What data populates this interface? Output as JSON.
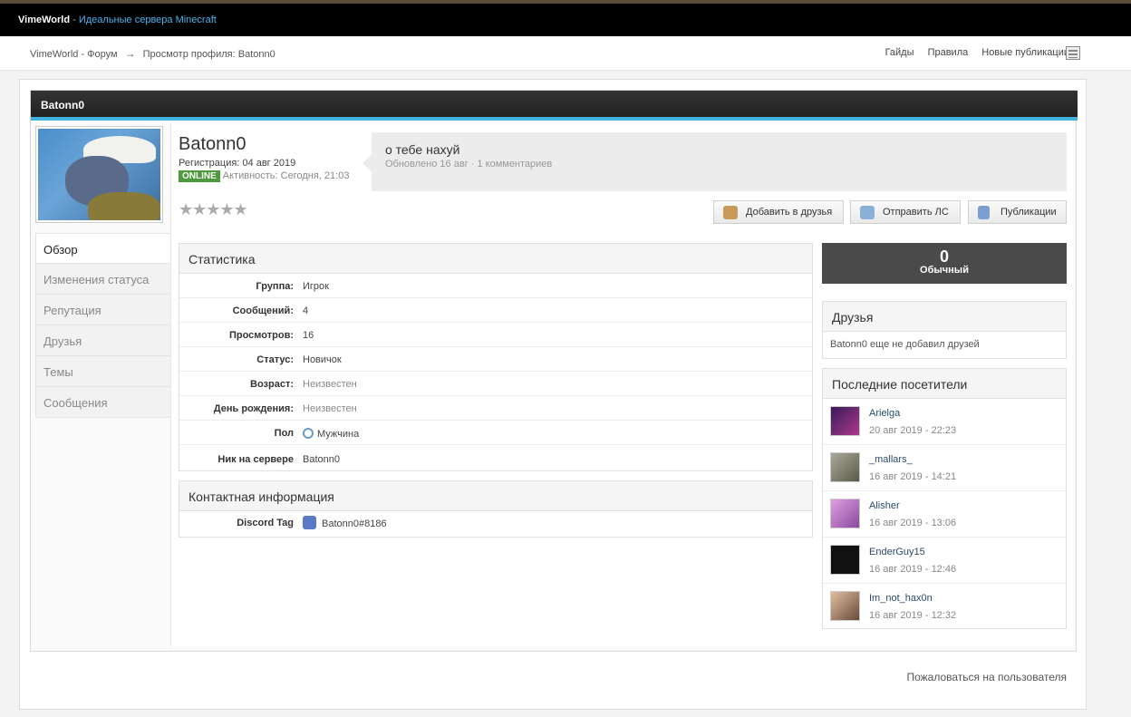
{
  "topbar": {
    "site": "VimeWorld",
    "sep": " - ",
    "tagline": "Идеальные сервера Minecraft"
  },
  "navbar": {
    "breadcrumbs": [
      "VimeWorld - Форум",
      "Просмотр профиля: Batonn0"
    ],
    "arrow": "→",
    "links": [
      "Гайды",
      "Правила",
      "Новые публикации"
    ]
  },
  "card": {
    "title": "Batonn0"
  },
  "sidenav": [
    "Обзор",
    "Изменения статуса",
    "Репутация",
    "Друзья",
    "Темы",
    "Сообщения"
  ],
  "profile": {
    "name": "Batonn0",
    "registered": "Регистрация: 04 авг 2019",
    "online_badge": "ONLINE",
    "activity": "Активность: Сегодня, 21:03",
    "stars": "★★★★★"
  },
  "status": {
    "text": "о тебе нахуй",
    "meta": "Обновлено 16 авг · 1 комментариев"
  },
  "buttons": {
    "add_friend": "Добавить в друзья",
    "send_pm": "Отправить ЛС",
    "posts": "Публикации"
  },
  "stats": {
    "title": "Статистика",
    "rows": [
      {
        "k": "Группа:",
        "v": "Игрок"
      },
      {
        "k": "Сообщений:",
        "v": "4"
      },
      {
        "k": "Просмотров:",
        "v": "16"
      },
      {
        "k": "Статус:",
        "v": "Новичок"
      },
      {
        "k": "Возраст:",
        "v": "Неизвестен"
      },
      {
        "k": "День рождения:",
        "v": "Неизвестен"
      },
      {
        "k": "Пол",
        "v": "Мужчина"
      },
      {
        "k": "Ник на сервере",
        "v": "Batonn0"
      }
    ]
  },
  "contact": {
    "title": "Контактная информация",
    "label": "Discord Tag",
    "value": "Batonn0#8186"
  },
  "reputation": {
    "value": "0",
    "label": "Обычный"
  },
  "friends": {
    "title": "Друзья",
    "text": "Batonn0 еще не добавил друзей"
  },
  "visitors": {
    "title": "Последние посетители",
    "items": [
      {
        "name": "Arielga",
        "time": "20 авг 2019 - 22:23",
        "color": "#6a3a8a"
      },
      {
        "name": "_mallars_",
        "time": "16 авг 2019 - 14:21",
        "color": "#8a8a7a"
      },
      {
        "name": "Alisher",
        "time": "16 авг 2019 - 13:06",
        "color": "#c078c8"
      },
      {
        "name": "EnderGuy15",
        "time": "16 авг 2019 - 12:46",
        "color": "#111111"
      },
      {
        "name": "Im_not_hax0n",
        "time": "16 авг 2019 - 12:32",
        "color": "#c89a7a"
      }
    ]
  },
  "report": "Пожаловаться на пользователя"
}
